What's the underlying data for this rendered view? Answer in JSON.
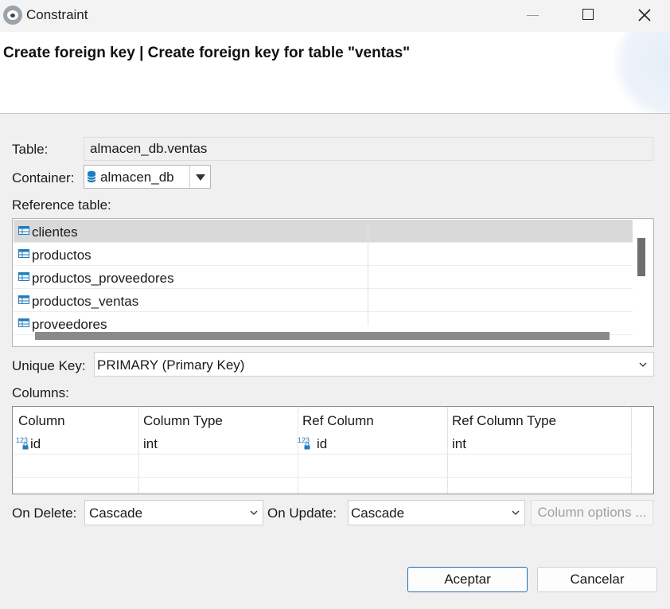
{
  "window": {
    "title": "Constraint",
    "icon": "app-icon",
    "controls": [
      "minimize-icon",
      "maximize-icon",
      "close-icon"
    ]
  },
  "header": {
    "text": "Create foreign key | Create foreign key for table \"ventas\""
  },
  "form": {
    "table_label": "Table:",
    "table_value": "almacen_db.ventas",
    "container_label": "Container:",
    "container_value": "almacen_db",
    "container_icon": "database-icon",
    "reference_table_label": "Reference table:",
    "reference_tables": [
      {
        "name": "clientes",
        "selected": true
      },
      {
        "name": "productos",
        "selected": false
      },
      {
        "name": "productos_proveedores",
        "selected": false
      },
      {
        "name": "productos_ventas",
        "selected": false
      },
      {
        "name": "proveedores",
        "selected": false
      }
    ],
    "unique_key_label": "Unique Key:",
    "unique_key_value": "PRIMARY (Primary Key)",
    "columns_label": "Columns:",
    "columns": {
      "headers": [
        "Column",
        "Column Type",
        "Ref Column",
        "Ref Column Type"
      ],
      "rows": [
        {
          "column": "id",
          "column_type": "int",
          "ref_column": "id",
          "ref_column_type": "int"
        }
      ],
      "key_icon_text": "123"
    },
    "on_delete_label": "On Delete:",
    "on_delete_value": "Cascade",
    "on_update_label": "On Update:",
    "on_update_value": "Cascade",
    "column_options_label": "Column options ..."
  },
  "buttons": {
    "ok": "Aceptar",
    "cancel": "Cancelar"
  },
  "colors": {
    "accent": "#1e6fb8",
    "selected_row": "#d9d9d9",
    "table_icon": "#1f7dbf"
  }
}
